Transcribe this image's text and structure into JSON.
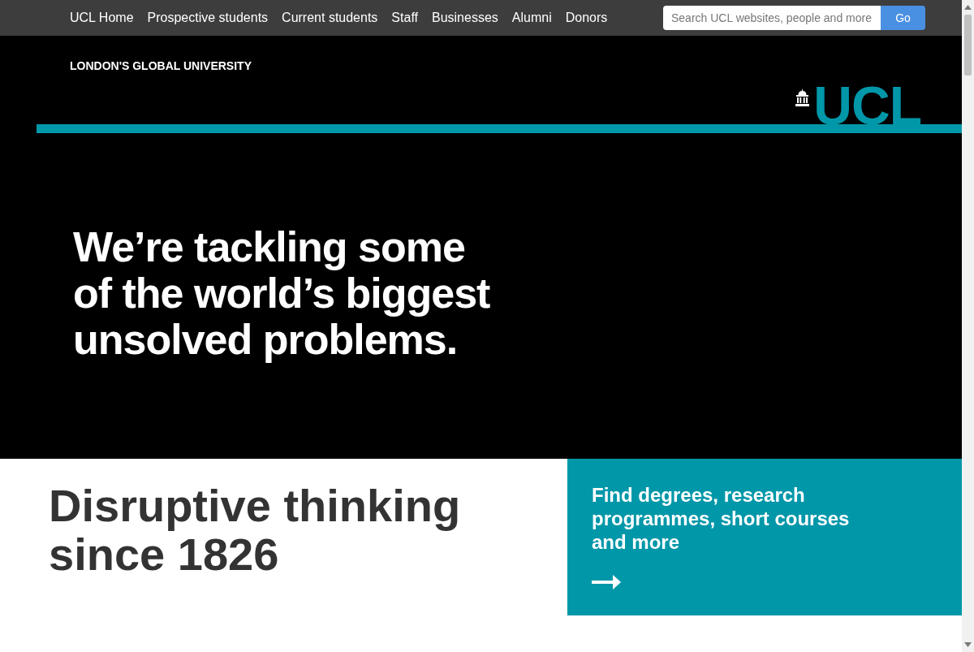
{
  "top_nav": {
    "links": [
      {
        "label": "UCL Home"
      },
      {
        "label": "Prospective students"
      },
      {
        "label": "Current students"
      },
      {
        "label": "Staff"
      },
      {
        "label": "Businesses"
      },
      {
        "label": "Alumni"
      },
      {
        "label": "Donors"
      }
    ],
    "search": {
      "placeholder": "Search UCL websites, people and more",
      "button": "Go"
    }
  },
  "header": {
    "tagline": "LONDON'S GLOBAL UNIVERSITY",
    "logo_text": "UCL"
  },
  "hero": {
    "headline": "We’re tackling some of the world’s biggest unsolved problems."
  },
  "intro": {
    "heading": "Disruptive thinking since 1826",
    "promo": {
      "text": "Find degrees, research programmes, short courses and more"
    }
  }
}
